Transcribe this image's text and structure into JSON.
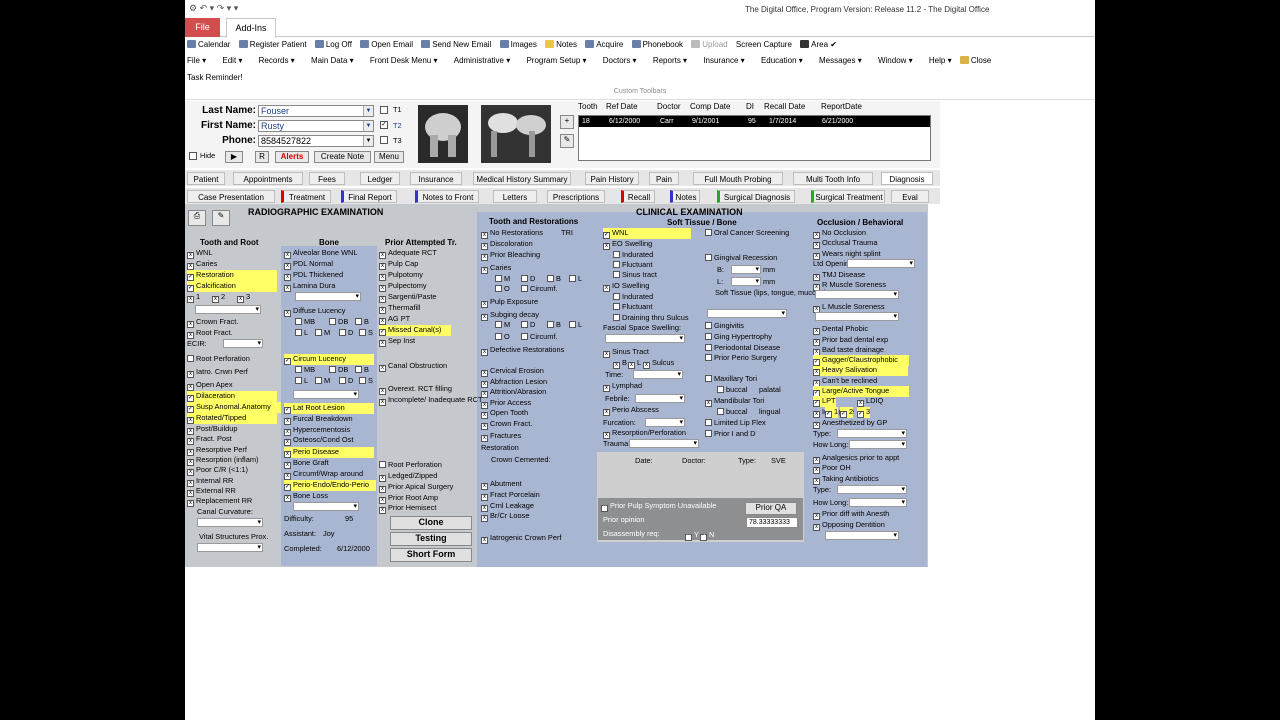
{
  "window": {
    "title": "The Digital Office, Program Version: Release 11.2  -  The Digital Office",
    "tabs": [
      "File",
      "Add-Ins"
    ]
  },
  "toolbar1": [
    "Calendar",
    "Register Patient",
    "Log Off",
    "Open Email",
    "Send New Email",
    "Images",
    "Notes",
    "Acquire",
    "Phonebook",
    "Upload",
    "Screen Capture",
    "Area"
  ],
  "toolbar2": [
    "File",
    "Edit",
    "Records",
    "Main Data",
    "Front Desk Menu",
    "Administrative",
    "Program Setup",
    "Doctors",
    "Reports",
    "Insurance",
    "Education",
    "Messages",
    "Window",
    "Help",
    "Close"
  ],
  "task_reminder": "Task Reminder!",
  "custom_toolbars": "Custom Toolbars",
  "patient": {
    "last_label": "Last Name:",
    "last": "Fouser",
    "first_label": "First Name:",
    "first": "Rusty",
    "phone_label": "Phone:",
    "phone": "8584527822",
    "t1": "T1",
    "t2": "T2",
    "t3": "T3",
    "hide": "Hide",
    "r": "R",
    "alerts": "Alerts",
    "create_note": "Create Note",
    "menu": "Menu"
  },
  "history": {
    "headers": [
      "Tooth",
      "Ref Date",
      "Doctor",
      "Comp Date",
      "DI",
      "Recall Date",
      "ReportDate"
    ],
    "row": [
      "18",
      "6/12/2000",
      "Carr",
      "9/1/2001",
      "95",
      "1/7/2014",
      "6/21/2000"
    ]
  },
  "tabs1": [
    "Patient",
    "Appointments",
    "Fees",
    "Ledger",
    "Insurance",
    "Medical History Summary",
    "Pain History",
    "Pain",
    "Full Mouth Probing",
    "Multi Tooth Info",
    "Diagnosis"
  ],
  "tabs2": [
    "Case Presentation",
    "Treatment",
    "Final Report",
    "Notes to Front",
    "Letters",
    "Prescriptions",
    "Recall",
    "Notes",
    "Surgical Diagnosis",
    "Surgical Treatment",
    "Eval"
  ],
  "radio": {
    "title": "RADIOGRAPHIC EXAMINATION",
    "tooth_root": "Tooth and Root",
    "bone": "Bone",
    "prior": "Prior Attempted Tr.",
    "tr_items": [
      "WNL",
      "Caries",
      "Restoration",
      "Calcification",
      "1",
      "2",
      "3",
      "Crown Fract.",
      "Root Fract.",
      "ECIR:",
      "Root Perforation",
      "Iatro. Crwn Perf",
      "Open Apex",
      "Dilaceration",
      "Susp Anomal.Anatomy",
      "Rotated/Tipped",
      "Post/Buildup",
      "Fract. Post",
      "Resorptive Perf",
      "Resorption (inflam)",
      "Poor C/R (<1:1)",
      "Internal RR",
      "External RR",
      "Replacement RR",
      "Canal Curvature:",
      "3",
      "Vital Structures Prox."
    ],
    "bone_items": [
      "Alveolar Bone WNL",
      "PDL Normal",
      "PDL Thickened",
      "Lamina Dura",
      "Diffuse Lucency",
      "MB",
      "DB",
      "B",
      "L",
      "M",
      "D",
      "S",
      "Circum Lucency",
      "MB",
      "DB",
      "B",
      "L",
      "M",
      "D",
      "S",
      "4mm",
      "Lat Root Lesion",
      "Furcal Breakdown",
      "Hypercementosis",
      "Osteosc/Cond Ost",
      "Perio Disease",
      "Bone Graft",
      "Circumf/Wrap around",
      "Perio-Endo/Endo-Perio",
      "Bone Loss",
      "Difficulty:",
      "95",
      "Assistant:",
      "Joy",
      "Completed:",
      "6/12/2000"
    ],
    "prior_items": [
      "Adequate RCT",
      "Pulp Cap",
      "Pulpotomy",
      "Pulpectomy",
      "Sargenti/Paste",
      "Thermafill",
      "AG PT",
      "Missed Canal(s)",
      "Sep Inst",
      "Overext. RCT filling",
      "Incomplete/ Inadequate RCT",
      "Canal Obstruction",
      "Root Perforation",
      "Ledged/Zipped",
      "Prior Apical Surgery",
      "Prior Root Amp",
      "Prior Hemisect"
    ],
    "clone": "Clone",
    "testing": "Testing",
    "short_form": "Short Form"
  },
  "clinical": {
    "title": "CLINICAL EXAMINATION",
    "soft": "Soft Tissue / Bone",
    "tooth_rest": "Tooth and Restorations",
    "tr_items": [
      "No Restorations",
      "TRI",
      "Discoloration",
      "Prior Bleaching",
      "Caries",
      "M",
      "D",
      "B",
      "L",
      "O",
      "Circumf.",
      "Pulp Exposure",
      "Subging decay",
      "M",
      "D",
      "B",
      "L",
      "O",
      "Circumf.",
      "Defective Restorations",
      "Cervical Erosion",
      "Abfraction Lesion",
      "Attrition/Abrasion",
      "Prior Access",
      "Open Tooth",
      "Crown Fract.",
      "Fractures",
      "Restoration",
      "Crown Cemented:",
      "Abutment",
      "Fract Porcelain",
      "Crnl Leakage",
      "Br/Cr Loose",
      "Iatrogenic Crown Perf"
    ],
    "soft_items": [
      "WNL",
      "EO Swelling",
      "Indurated",
      "Fluctuant",
      "Sinus tract",
      "IO Swelling",
      "Indurated",
      "Fluctuant",
      "Draining thru Sulcus",
      "Fascial Space Swelling:",
      "Sinus Tract",
      "B",
      "L",
      "Sulcus",
      "Time:",
      "Lymphad",
      "Febrile:",
      "Perio Abscess",
      "Furcation:",
      "1",
      "Resorption/Perforation",
      "Trauma:",
      "Oral Cancer Screening",
      "Gingival Recession",
      "B:",
      "mm",
      "L:",
      "mm",
      "Soft Tissue (lips, tongue, mucosa):",
      "Gingivitis",
      "Ging Hypertrophy",
      "Periodontal Disease",
      "Prior Perio Surgery",
      "Maxillary Tori",
      "buccal",
      "palatal",
      "Mandibular Tori",
      "buccal",
      "lingual",
      "Limited Lip Flex",
      "Prior I and D"
    ],
    "date_headers": [
      "Date:",
      "Doctor:",
      "Type:",
      "SVE"
    ],
    "prior_pulp": "Prior Pulp Symptom Unavailable",
    "prior_qa": "Prior QA",
    "prior_opinion": "Prior opinion",
    "score": "78.33333333",
    "disassembly": "Disassembly req:",
    "y": "Y",
    "n": "N"
  },
  "occlusion": {
    "title": "Occlusion / Behavioral",
    "items": [
      "No Occlusion",
      "Occlusal Trauma",
      "Wears night splint",
      "Ltd Opening",
      "TMJ Disease",
      "R Muscle Soreness",
      "L Muscle Soreness",
      "Dental Phobic",
      "Prior bad dental exp",
      "Bad taste drainage",
      "Gagger/Claustrophobic",
      "Heavy Salivation",
      "Can't be reclined",
      "Large/Active Tongue",
      "LPT",
      "LDIQ",
      "Intangible",
      "1",
      "2",
      "3",
      "Anesthetized by GP",
      "Type:",
      "How Long:",
      "Analgesics prior to appt",
      "Poor OH",
      "Taking Antibiotics",
      "Type:",
      "How Long:",
      "Prior diff with Anesth",
      "Opposing Dentition"
    ]
  }
}
